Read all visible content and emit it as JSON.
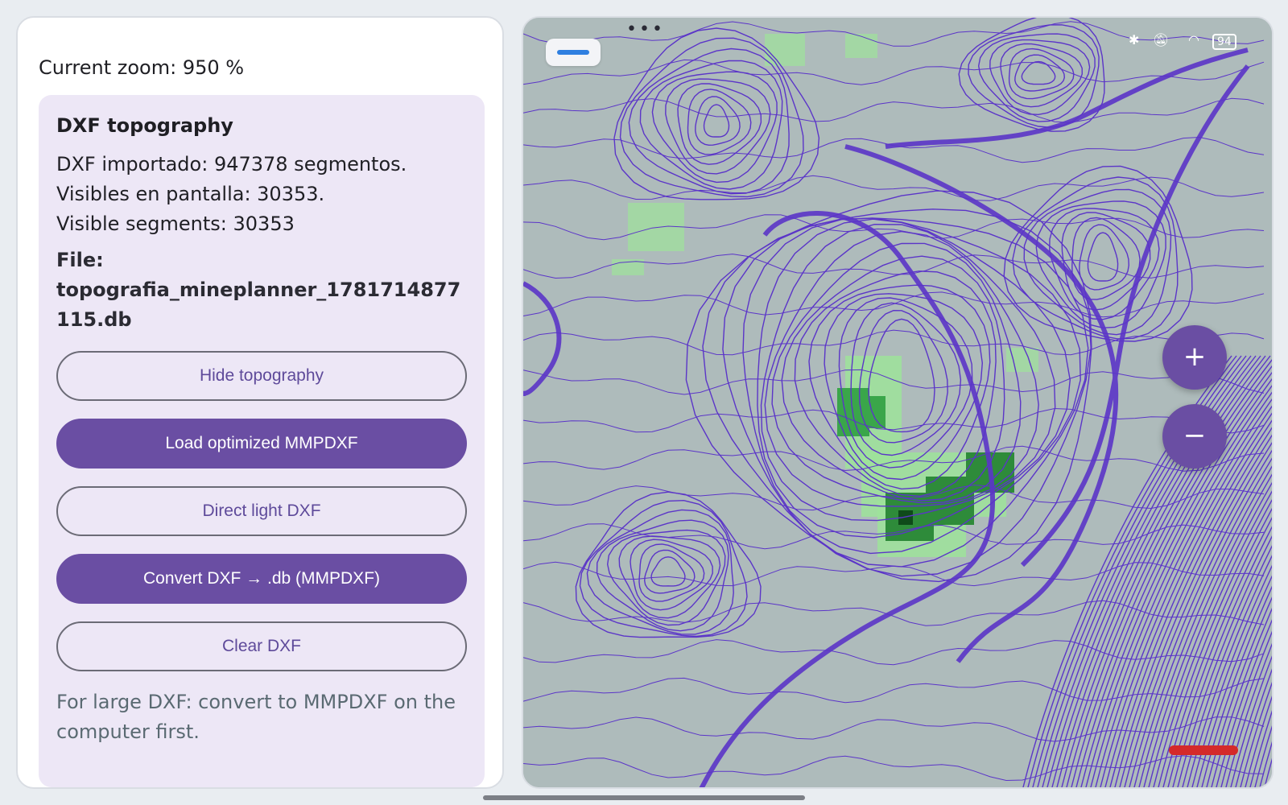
{
  "panel": {
    "zoom_text": "Current zoom: 950 %",
    "card": {
      "title": "DXF topography",
      "lines": [
        "DXF importado: 947378 segmentos.",
        "Visibles en pantalla: 30353.",
        "Visible segments: 30353"
      ],
      "file_label": "File:",
      "file_name": "topografia_mineplanner_1781714877115.db",
      "buttons": {
        "hide": "Hide topography",
        "load_optimized": "Load optimized MMPDXF",
        "direct_light": "Direct light DXF",
        "convert": "Convert DXF → .db (MMPDXF)",
        "clear": "Clear DXF"
      },
      "hint": "For large DXF: convert to MMPDXF on the computer first."
    }
  },
  "map": {
    "zoom_in": "+",
    "zoom_out": "−",
    "status": {
      "battery": "94",
      "icons": [
        "bluetooth-icon",
        "mute-icon",
        "wifi-icon",
        "battery-icon"
      ]
    },
    "dots": "•••"
  },
  "colors": {
    "accent": "#6a4ea3",
    "contour": "#5b35c8",
    "map_bg": "#aebbbb",
    "vegetation_light": "#9ee39a",
    "vegetation_dark": "#2e8b3a",
    "scale_bar": "#d42a2a"
  }
}
